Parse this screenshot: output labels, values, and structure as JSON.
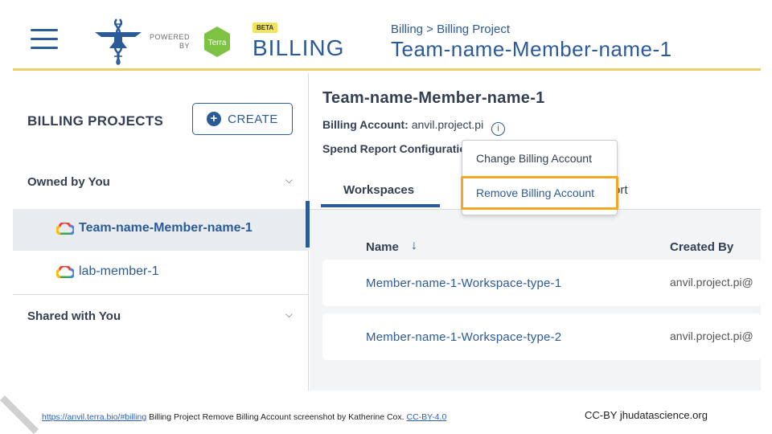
{
  "header": {
    "powered_line1": "POWERED",
    "powered_line2": "BY",
    "terra_label": "Terra",
    "beta_badge": "BETA",
    "app_name": "BILLING",
    "breadcrumb": "Billing > Billing Project",
    "title": "Team-name-Member-name-1"
  },
  "sidebar": {
    "heading": "BILLING PROJECTS",
    "create_label": "CREATE",
    "owned_section": "Owned by You",
    "owned_projects": [
      "Team-name-Member-name-1",
      "lab-member-1"
    ],
    "shared_section": "Shared with You"
  },
  "main": {
    "title": "Team-name-Member-name-1",
    "billing_account_label": "Billing Account:",
    "billing_account_value": "anvil.project.pi",
    "spend_report_label": "Spend Report Configuration",
    "tabs": [
      "Workspaces",
      "ort"
    ],
    "columns": {
      "name": "Name",
      "created_by": "Created By"
    },
    "rows": [
      {
        "name": "Member-name-1-Workspace-type-1",
        "created_by": "anvil.project.pi@"
      },
      {
        "name": "Member-name-1-Workspace-type-2",
        "created_by": "anvil.project.pi@"
      }
    ]
  },
  "menu": {
    "items": [
      "Change Billing Account",
      "Remove Billing Account"
    ]
  },
  "footer": {
    "link": "https://anvil.terra.bio/#billing",
    "caption": " Billing Project Remove  Billing Account screenshot by Katherine Cox. ",
    "license": "CC-BY-4.0",
    "right": "CC-BY  jhudatascience.org"
  },
  "colors": {
    "accent": "#2b5a99",
    "highlight": "#f5a623",
    "header_border": "#e8cf6a",
    "terra_green": "#7dc242"
  }
}
